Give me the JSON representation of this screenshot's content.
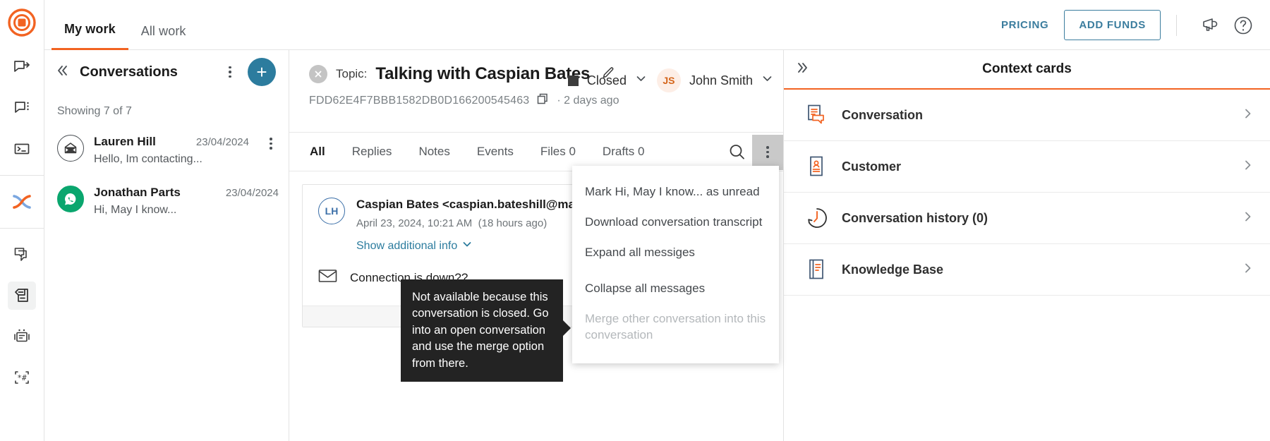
{
  "brand": {
    "accent": "#f26322",
    "link": "#2c7c9e",
    "dark": "#232323"
  },
  "rail": {
    "logo_name": "app-logo",
    "items": [
      {
        "name": "chat-forward-icon",
        "label": "Transfer chat"
      },
      {
        "name": "chat-options-icon",
        "label": "Chat options"
      },
      {
        "name": "terminal-icon",
        "label": "Console"
      },
      {
        "name": "crossover-icon",
        "label": "Crossover"
      },
      {
        "name": "copy-chats-icon",
        "label": "Chat copies"
      },
      {
        "name": "archive-icon",
        "label": "Archive"
      },
      {
        "name": "bot-icon",
        "label": "Bots"
      },
      {
        "name": "macro-icon",
        "label": "Macros"
      }
    ]
  },
  "topbar": {
    "tabs": [
      {
        "label": "My work",
        "active": true
      },
      {
        "label": "All work",
        "active": false
      }
    ],
    "pricing_label": "PRICING",
    "add_funds_label": "ADD FUNDS",
    "megaphone_icon": "megaphone-icon",
    "help_icon": "help-circle-icon"
  },
  "list": {
    "title": "Conversations",
    "collapse_icon": "collapse-left-icon",
    "kebab_icon": "more-options-icon",
    "add_label": "+",
    "showing": "Showing 7 of 7",
    "rows": [
      {
        "avatar_icon": "envelope-open-icon",
        "avatar_style": "outline",
        "name": "Lauren Hill",
        "date": "23/04/2024",
        "snippet": "Hello, Im contacting...",
        "has_kebab": true
      },
      {
        "avatar_icon": "whatsapp-icon",
        "avatar_style": "green",
        "name": "Jonathan Parts",
        "date": "23/04/2024",
        "snippet": "Hi, May I know...",
        "has_kebab": false
      }
    ]
  },
  "conversation": {
    "close_icon": "close-circle-icon",
    "topic_label": "Topic:",
    "topic_value": "Talking with Caspian Bates",
    "edit_icon": "pencil-icon",
    "id": "FDD62E4F7BBB1582DB0D166200545463",
    "copy_icon": "copy-icon",
    "age": "· 2 days ago",
    "status": "Closed",
    "status_chevron": "chevron-down-icon",
    "agent_initials": "JS",
    "agent_name": "John Smith",
    "agent_chevron": "chevron-down-icon",
    "tabs": [
      {
        "label": "All",
        "active": true
      },
      {
        "label": "Replies",
        "active": false
      },
      {
        "label": "Notes",
        "active": false
      },
      {
        "label": "Events",
        "active": false
      },
      {
        "label": "Files 0",
        "active": false
      },
      {
        "label": "Drafts 0",
        "active": false
      }
    ],
    "search_icon": "search-icon",
    "kebab_icon": "more-options-icon",
    "message": {
      "avatar_initials": "LH",
      "from": "Caspian Bates <caspian.bateshill@mail.com",
      "timestamp": "April 23, 2024, 10:21 AM",
      "relative": "(18 hours ago)",
      "additional_info_label": "Show additional info",
      "additional_info_chevron": "chevron-down-icon",
      "envelope_icon": "envelope-icon",
      "subject": "Connection is down??"
    }
  },
  "menu": {
    "items": [
      {
        "label": "Mark Hi, May I know... as unread",
        "disabled": false
      },
      {
        "label": "Download conversation transcript",
        "disabled": false
      },
      {
        "label": "Expand all messiges",
        "disabled": false
      },
      {
        "label": "Collapse all messages",
        "disabled": false
      },
      {
        "label": "Merge other conversation into this conversation",
        "disabled": true
      }
    ]
  },
  "tooltip": {
    "text": "Not available because this conversation is closed. Go into an open conversation and use the merge option from there."
  },
  "context": {
    "expand_icon": "expand-right-icon",
    "title": "Context cards",
    "cards": [
      {
        "label": "Conversation",
        "icon": "conversation-card-icon",
        "chevron": "chevron-right-icon"
      },
      {
        "label": "Customer",
        "icon": "customer-card-icon",
        "chevron": "chevron-right-icon"
      },
      {
        "label": "Conversation history (0)",
        "icon": "history-card-icon",
        "chevron": "chevron-right-icon"
      },
      {
        "label": "Knowledge Base",
        "icon": "knowledge-base-icon",
        "chevron": "chevron-right-icon"
      }
    ]
  }
}
